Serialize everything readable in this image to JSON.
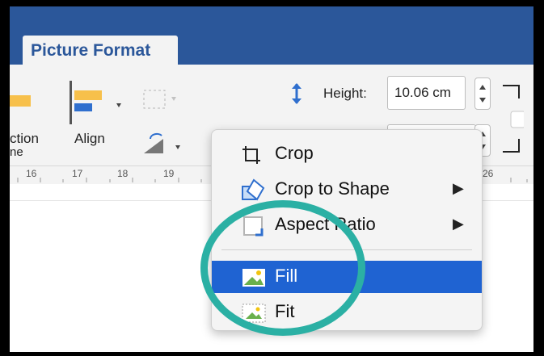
{
  "app": {
    "tab_label": "Picture Format"
  },
  "ribbon": {
    "selection_pane_label_line1": "ction",
    "selection_pane_label_line2": "ne",
    "align_label": "Align",
    "height_label": "Height:",
    "height_value": "10.06 cm"
  },
  "ruler": {
    "ticks": [
      "16",
      "17",
      "18",
      "19",
      "26"
    ]
  },
  "crop_menu": {
    "items": [
      {
        "label": "Crop",
        "icon": "crop-icon",
        "submenu": false,
        "selected": false
      },
      {
        "label": "Crop to Shape",
        "icon": "crop-to-shape-icon",
        "submenu": true,
        "selected": false
      },
      {
        "label": "Aspect Ratio",
        "icon": "aspect-ratio-icon",
        "submenu": true,
        "selected": false
      },
      {
        "label": "Fill",
        "icon": "fill-icon",
        "submenu": false,
        "selected": true
      },
      {
        "label": "Fit",
        "icon": "fit-icon",
        "submenu": false,
        "selected": false
      }
    ]
  },
  "colors": {
    "title_bar": "#2b579a",
    "selected_item": "#1f63d2",
    "highlight_circle": "#2bb0a4",
    "frame_border": "#000000"
  }
}
